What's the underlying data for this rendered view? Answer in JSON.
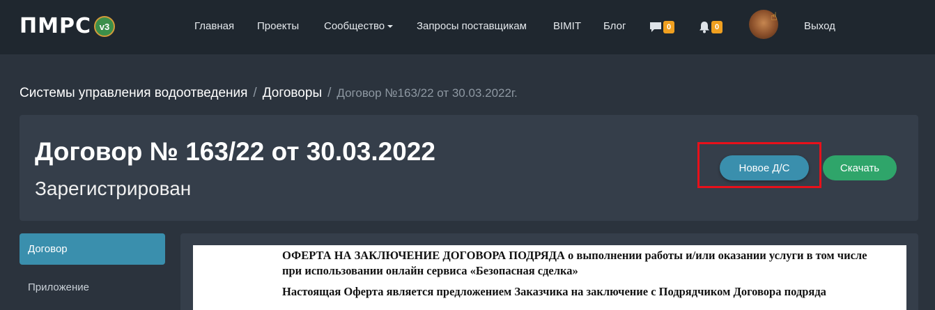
{
  "brand": {
    "name": "ПМРС",
    "version": "v3"
  },
  "nav": {
    "items": [
      "Главная",
      "Проекты",
      "Сообщество",
      "Запросы поставщикам",
      "BIMIT",
      "Блог"
    ],
    "messages_count": "0",
    "notifications_count": "0",
    "logout_label": "Выход"
  },
  "breadcrumb": {
    "items": [
      "Системы управления водоотведения",
      "Договоры"
    ],
    "separator": "/",
    "current": "Договор №163/22 от 30.03.2022г."
  },
  "header": {
    "title": "Договор № 163/22 от 30.03.2022",
    "status": "Зарегистрирован",
    "new_button": "Новое Д/С",
    "download_button": "Скачать"
  },
  "sidebar": {
    "items": [
      "Договор",
      "Приложение"
    ],
    "active_index": 0
  },
  "document": {
    "line1": "ОФЕРТА НА ЗАКЛЮЧЕНИЕ ДОГОВОРА ПОДРЯДА о выполнении работы и/или оказании услуги в том числе при использовании онлайн сервиса «Безопасная сделка»",
    "line2": "Настоящая Оферта является предложением Заказчика на заключение с Подрядчиком Договора подряда"
  },
  "colors": {
    "navbar": "#1f272f",
    "page_bg": "#2b333d",
    "card_bg": "#353e4a",
    "accent_blue": "#3a8fad",
    "accent_green": "#2fa56a",
    "badge": "#f0a020",
    "highlight": "#e8101a"
  }
}
